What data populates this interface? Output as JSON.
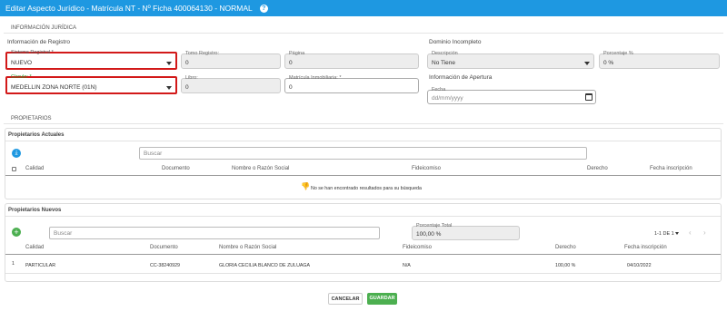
{
  "title": "Editar Aspecto Jurídico - Matrícula NT - Nº Ficha 400064130 - NORMAL",
  "sections": {
    "juridica": "INFORMACIÓN JURÍDICA",
    "propietarios": "PROPIETARIOS"
  },
  "registro": {
    "heading": "Información de Registro",
    "sistema_label": "Sistema Registral *",
    "sistema_value": "NUEVO",
    "tomo_label": "Tomo Registro:",
    "tomo_value": "0",
    "pagina_label": "Página",
    "pagina_value": "0",
    "circulo_label": "Círculo: *",
    "circulo_value": "MEDELLIN ZONA NORTE (01N)",
    "libro_label": "Libro:",
    "libro_value": "0",
    "matricula_label": "Matrícula Inmobiliaria: *",
    "matricula_value": "0"
  },
  "dominio": {
    "heading": "Dominio Incompleto",
    "descripcion_label": "Descripción",
    "descripcion_value": "No Tiene",
    "porcentaje_label": "Porcentaje %",
    "porcentaje_value": "0 %",
    "apertura_heading": "Información de Apertura",
    "fecha_label": "Fecha",
    "fecha_placeholder": "dd/mm/yyyy"
  },
  "actuales": {
    "heading": "Propietarios Actuales",
    "search_placeholder": "Buscar",
    "columns": [
      "Calidad",
      "Documento",
      "Nombre o Razón Social",
      "Fideicomiso",
      "Derecho",
      "Fecha inscripción"
    ],
    "empty_message": "No se han encontrado resultados para su búsqueda"
  },
  "nuevos": {
    "heading": "Propietarios Nuevos",
    "search_placeholder": "Buscar",
    "porcentaje_label": "Porcentaje Total",
    "porcentaje_value": "100,00 %",
    "pagination": "1-1 DE 1",
    "columns": [
      "Calidad",
      "Documento",
      "Nombre o Razón Social",
      "Fideicomiso",
      "Derecho",
      "Fecha inscripción"
    ],
    "rows": [
      {
        "index": "1",
        "calidad": "PARTICULAR",
        "documento": "CC-38240929",
        "nombre": "GLORIA CECILIA BLANCO DE ZULUAGA",
        "fideicomiso": "N/A",
        "derecho": "100,00 %",
        "fecha": "04/10/2022"
      }
    ]
  },
  "footer": {
    "cancel": "CANCELAR",
    "save": "GUARDAR"
  },
  "colors": {
    "header_blue": "#1e98e1",
    "highlight_red": "#d21919",
    "save_green": "#4caf50"
  }
}
